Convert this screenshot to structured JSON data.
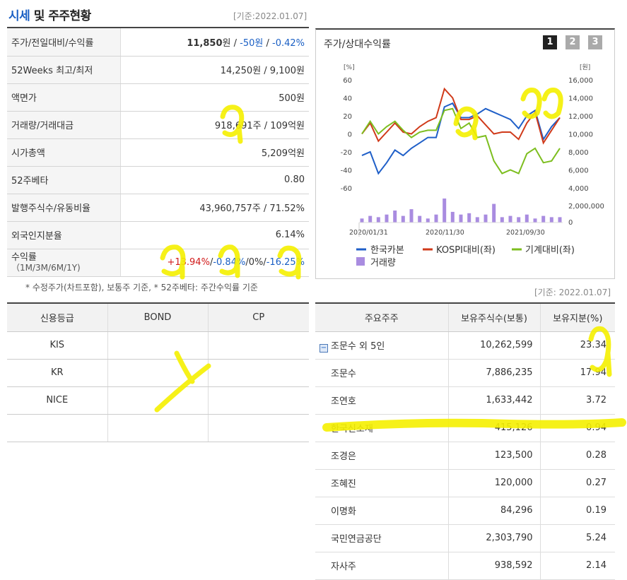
{
  "header": {
    "title_blue": "시세",
    "title_rest": " 및 주주현황",
    "basis": "[기준:2022.01.07]"
  },
  "quote_table": {
    "rows": [
      {
        "label": "주가/전일대비/수익률",
        "price": "11,850",
        "unit": "원",
        "sep1": " / ",
        "change": "-50원",
        "sep2": " / ",
        "rate": "-0.42%"
      },
      {
        "label": "52Weeks 최고/최저",
        "value": "14,250원 / 9,100원"
      },
      {
        "label": "액면가",
        "value": "500원"
      },
      {
        "label": "거래량/거래대금",
        "value": "918,691주 / 109억원"
      },
      {
        "label": "시가총액",
        "value": "5,209억원"
      },
      {
        "label": "52주베타",
        "value": "0.80"
      },
      {
        "label": "발행주식수/유동비율",
        "value": "43,960,757주 / 71.52%"
      },
      {
        "label": "외국인지분율",
        "value": "6.14%"
      },
      {
        "label": "수익률",
        "sublabel": "（1M/3M/6M/1Y)",
        "r1": "+13.94%",
        "r2": "-0.84%",
        "r3": "0%",
        "r4": "-16.25%",
        "slash": "/"
      }
    ],
    "note": "* 수정주가(차트포함), 보통주 기준, * 52주베타: 주간수익률 기준"
  },
  "chart_panel": {
    "title": "주가/상대수익률",
    "pages": [
      "1",
      "2",
      "3"
    ],
    "active_page": "1"
  },
  "chart_data": {
    "type": "line",
    "left_axis_unit": "[%]",
    "right_axis_unit": "[원]",
    "left_ticks": [
      "60",
      "40",
      "20",
      "0",
      "-20",
      "-40",
      "-60"
    ],
    "right_ticks": [
      "16,000",
      "14,000",
      "12,000",
      "10,000",
      "8,000",
      "6,000",
      "4,000"
    ],
    "volume_ticks": [
      "2,000,000",
      "0"
    ],
    "x_ticks": [
      "2020/01/31",
      "2020/11/30",
      "2021/09/30"
    ],
    "ylim_left": [
      -60,
      60
    ],
    "series": [
      {
        "name": "한국카본",
        "color": "#1f5fc8",
        "values": [
          -24,
          -20,
          -44,
          -32,
          -18,
          -24,
          -16,
          -10,
          -4,
          -4,
          30,
          34,
          18,
          18,
          22,
          28,
          24,
          20,
          16,
          6,
          20,
          26,
          -6,
          8,
          18
        ]
      },
      {
        "name": "KOSPI대비(좌)",
        "color": "#d03a1a",
        "values": [
          0,
          12,
          -8,
          2,
          12,
          2,
          0,
          8,
          14,
          18,
          50,
          40,
          16,
          16,
          20,
          10,
          0,
          2,
          2,
          -6,
          12,
          24,
          -10,
          4,
          18
        ]
      },
      {
        "name": "기계대비(좌)",
        "color": "#7dbe1f",
        "values": [
          0,
          14,
          0,
          8,
          14,
          4,
          -4,
          2,
          4,
          4,
          26,
          28,
          6,
          12,
          -4,
          -2,
          -30,
          -44,
          -40,
          -44,
          -22,
          -16,
          -32,
          -30,
          -16
        ]
      },
      {
        "name": "거래량",
        "color": "#a98ce0",
        "values": [
          3,
          5,
          4,
          6,
          9,
          5,
          10,
          5,
          3,
          6,
          18,
          8,
          6,
          7,
          4,
          6,
          14,
          4,
          5,
          4,
          6,
          3,
          5,
          4,
          4
        ]
      }
    ]
  },
  "credit_table": {
    "headers": [
      "신용등급",
      "BOND",
      "CP"
    ],
    "rows": [
      [
        "KIS",
        "",
        ""
      ],
      [
        "KR",
        "",
        ""
      ],
      [
        "NICE",
        "",
        ""
      ],
      [
        "",
        "",
        ""
      ]
    ]
  },
  "share_table": {
    "basis": "[기준: 2022.01.07]",
    "headers": [
      "주요주주",
      "보유주식수(보통)",
      "보유지분(%)"
    ],
    "rows": [
      {
        "name": "조문수 외 5인",
        "shares": "10,262,599",
        "pct": "23.34"
      },
      {
        "name": "조문수",
        "shares": "7,886,235",
        "pct": "17.94"
      },
      {
        "name": "조연호",
        "shares": "1,633,442",
        "pct": "3.72"
      },
      {
        "name": "한국신소재",
        "shares": "415,126",
        "pct": "0.94"
      },
      {
        "name": "조경은",
        "shares": "123,500",
        "pct": "0.28"
      },
      {
        "name": "조혜진",
        "shares": "120,000",
        "pct": "0.27"
      },
      {
        "name": "이명화",
        "shares": "84,296",
        "pct": "0.19"
      },
      {
        "name": "국민연금공단",
        "shares": "2,303,790",
        "pct": "5.24"
      },
      {
        "name": "자사주",
        "shares": "938,592",
        "pct": "2.14"
      }
    ]
  },
  "annotation_color": "#f5f000"
}
